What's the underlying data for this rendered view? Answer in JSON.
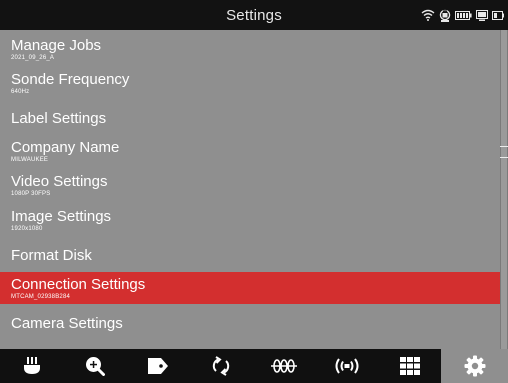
{
  "header": {
    "title": "Settings"
  },
  "status_icons": [
    "wifi-icon",
    "lock-icon",
    "battery-icon",
    "monitor-icon",
    "camera-battery-icon"
  ],
  "settings": [
    {
      "label": "Manage Jobs",
      "sub": "2021_09_26_A"
    },
    {
      "label": "Sonde Frequency",
      "sub": "640Hz"
    },
    {
      "label": "Label Settings"
    },
    {
      "label": "Company Name",
      "sub": "MILWAUKEE"
    },
    {
      "label": "Video Settings",
      "sub": "1080P  30FPS"
    },
    {
      "label": "Image Settings",
      "sub": "1920x1080"
    },
    {
      "label": "Format Disk"
    },
    {
      "label": "Connection Settings",
      "sub": "MTCAM_02938B284",
      "selected": true
    },
    {
      "label": "Camera Settings"
    }
  ],
  "bottom_bar": [
    {
      "icon": "cable-reel-icon"
    },
    {
      "icon": "zoom-in-icon"
    },
    {
      "icon": "tag-icon"
    },
    {
      "icon": "rotate-icon"
    },
    {
      "icon": "meter-counter-icon"
    },
    {
      "icon": "sonde-icon"
    },
    {
      "icon": "grid-icon"
    },
    {
      "icon": "settings-gear-icon",
      "active": true
    }
  ],
  "colors": {
    "background": "#8f8f8f",
    "selected": "#d32f2f",
    "bar": "#121212",
    "text": "#ffffff"
  }
}
